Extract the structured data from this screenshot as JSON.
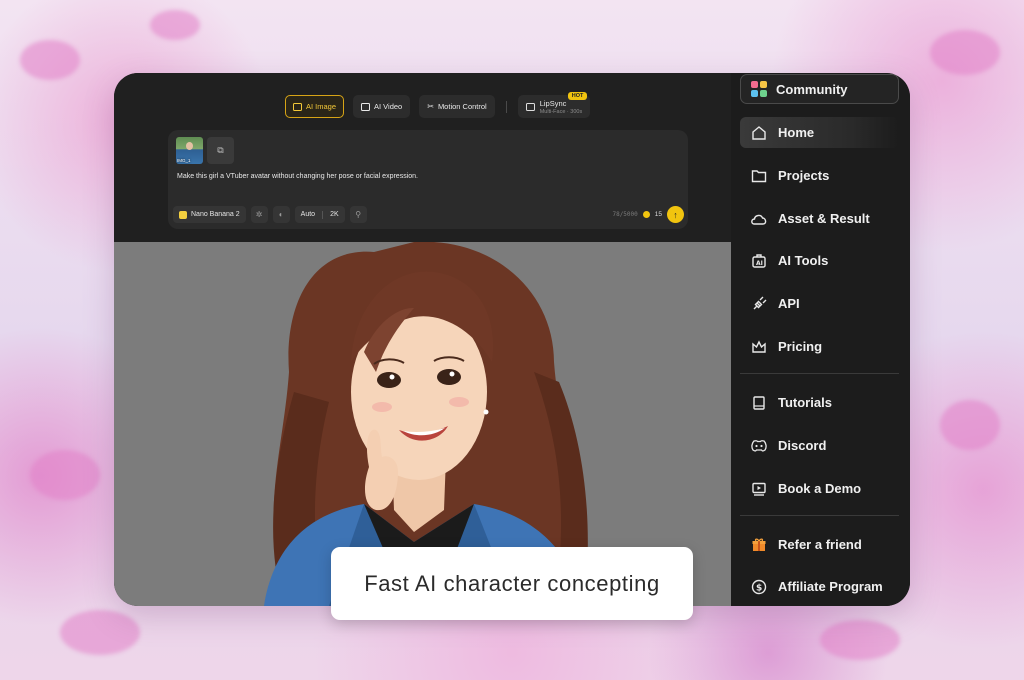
{
  "mode_tabs": [
    {
      "label": "AI Image",
      "icon": "image-icon",
      "active": true
    },
    {
      "label": "AI Video",
      "icon": "video-icon",
      "active": false
    },
    {
      "label": "Motion Control",
      "icon": "motion-icon",
      "active": false
    }
  ],
  "lipsync": {
    "label": "LipSync",
    "sublabel": "Multi-Face · 300s",
    "badge": "HOT",
    "icon": "lipsync-icon"
  },
  "prompt": {
    "thumbnail_label": "IMG_1",
    "text": "Make this girl a VTuber avatar without changing her pose or facial expression.",
    "model": "Nano Banana 2",
    "aspect": "Auto",
    "resolution": "2K",
    "char_count": "78/5000",
    "credits": "15"
  },
  "sidebar": {
    "community": {
      "label": "Community",
      "icon": "community-grid-icon"
    },
    "items": [
      {
        "label": "Home",
        "icon": "home-icon",
        "active": true
      },
      {
        "label": "Projects",
        "icon": "folder-icon"
      },
      {
        "label": "Asset & Result",
        "icon": "cloud-icon"
      },
      {
        "label": "AI Tools",
        "icon": "ai-tools-icon"
      },
      {
        "label": "API",
        "icon": "api-plug-icon"
      },
      {
        "label": "Pricing",
        "icon": "crown-icon"
      },
      {
        "label": "Tutorials",
        "icon": "book-icon"
      },
      {
        "label": "Discord",
        "icon": "discord-icon"
      },
      {
        "label": "Book a Demo",
        "icon": "play-demo-icon"
      },
      {
        "label": "Refer a friend",
        "icon": "gift-icon"
      },
      {
        "label": "Affiliate Program",
        "icon": "dollar-icon"
      }
    ]
  },
  "caption": "Fast AI character concepting",
  "colors": {
    "accent": "#f1c40f",
    "panel": "#1c1c1c",
    "canvas": "#7c7c7c"
  }
}
